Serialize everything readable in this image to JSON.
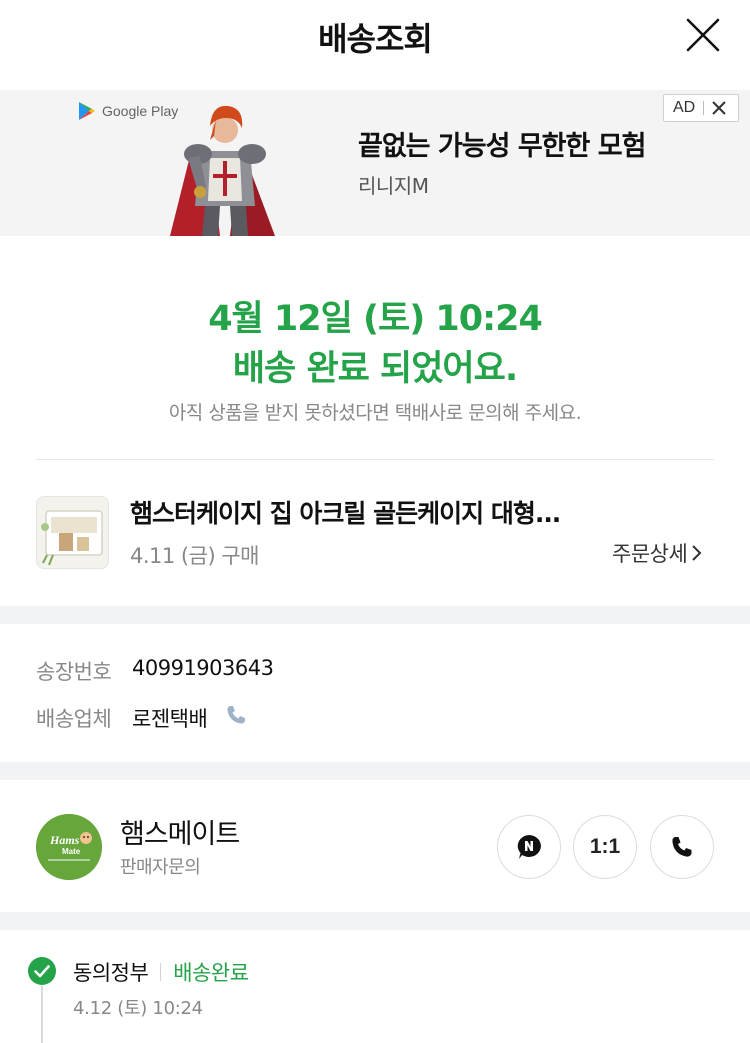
{
  "header": {
    "title": "배송조회",
    "close_icon": "close-icon"
  },
  "ad": {
    "store_label": "Google Play",
    "headline": "끝없는 가능성 무한한 모험",
    "app_name": "리니지M",
    "badge_label": "AD"
  },
  "status": {
    "date_line": "4월 12일 (토) 10:24",
    "message": "배송 완료 되었어요.",
    "note": "아직 상품을 받지 못하셨다면 택배사로 문의해 주세요."
  },
  "product": {
    "name": "햄스터케이지 집 아크릴 골든케이지 대형...",
    "purchase_date": "4.11 (금) 구매",
    "order_detail_label": "주문상세"
  },
  "shipment": {
    "tracking_label": "송장번호",
    "tracking_number": "40991903643",
    "carrier_label": "배송업체",
    "carrier_name": "로젠택배"
  },
  "seller": {
    "name": "햄스메이트",
    "subtitle": "판매자문의",
    "logo_text_1": "Hams",
    "logo_text_2": "Mate",
    "one_to_one_label": "1:1"
  },
  "tracking": {
    "location": "동의정부",
    "status": "배송완료",
    "time": "4.12 (토) 10:24"
  },
  "colors": {
    "accent_green": "#24a349",
    "band_gray": "#f2f3f5",
    "seller_logo_green": "#66a63a"
  }
}
